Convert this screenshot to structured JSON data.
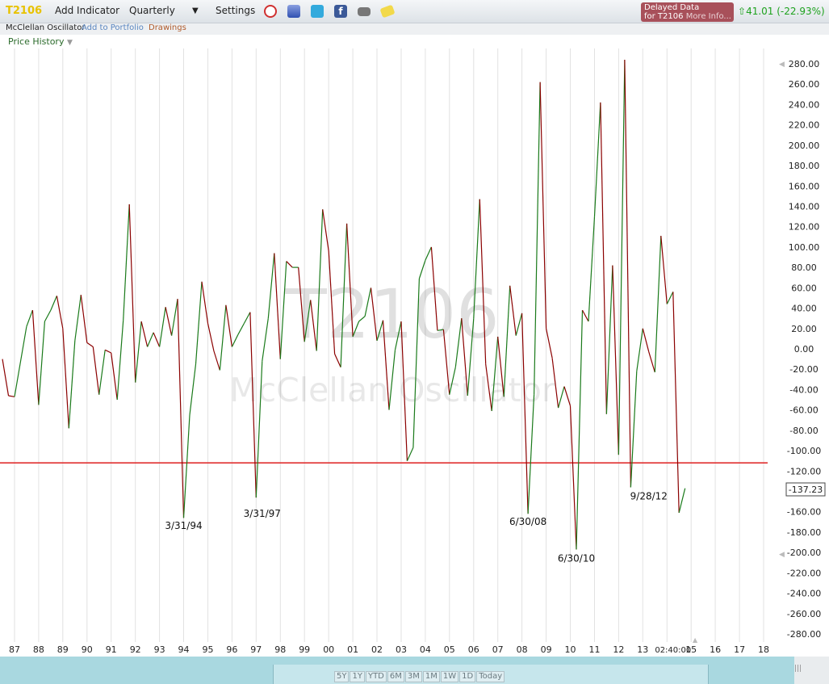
{
  "toolbar": {
    "symbol": "T2106",
    "add_indicator": "Add Indicator",
    "period": "Quarterly",
    "settings": "Settings"
  },
  "delayed": {
    "line1": "Delayed Data",
    "line2": "for T2106",
    "more": "More Info..."
  },
  "quote": {
    "text": "41.01 (-22.93%)",
    "color": "#1ea21e"
  },
  "subbar": {
    "indicator": "McClellan Oscillator",
    "add_portfolio": "Add to Portfolio",
    "drawings": "Drawings"
  },
  "price_history": "Price History",
  "watermark": {
    "symbol": "T2106",
    "name": "McClellan Oscillator"
  },
  "last_value_label": "-137.23",
  "time_label": "02:40:00",
  "nav_buttons": [
    "5Y",
    "1Y",
    "YTD",
    "6M",
    "3M",
    "1M",
    "1W",
    "1D",
    "Today"
  ],
  "colors": {
    "up": "#1a7a1a",
    "down": "#8b0000",
    "threshold": "#e03030"
  },
  "chart_data": {
    "type": "line",
    "ylim": [
      -280,
      280
    ],
    "yticks": [
      280,
      260,
      240,
      220,
      200,
      180,
      160,
      140,
      120,
      100,
      80,
      60,
      40,
      20,
      0,
      -20,
      -40,
      -60,
      -80,
      -100,
      -120,
      -140,
      -160,
      -180,
      -200,
      -220,
      -240,
      -260,
      -280
    ],
    "xlim": [
      1986.5,
      2018.3
    ],
    "xticks": [
      {
        "x": 1987,
        "label": "87"
      },
      {
        "x": 1988,
        "label": "88"
      },
      {
        "x": 1989,
        "label": "89"
      },
      {
        "x": 1990,
        "label": "90"
      },
      {
        "x": 1991,
        "label": "91"
      },
      {
        "x": 1992,
        "label": "92"
      },
      {
        "x": 1993,
        "label": "93"
      },
      {
        "x": 1994,
        "label": "94"
      },
      {
        "x": 1995,
        "label": "95"
      },
      {
        "x": 1996,
        "label": "96"
      },
      {
        "x": 1997,
        "label": "97"
      },
      {
        "x": 1998,
        "label": "98"
      },
      {
        "x": 1999,
        "label": "99"
      },
      {
        "x": 2000,
        "label": "00"
      },
      {
        "x": 2001,
        "label": "01"
      },
      {
        "x": 2002,
        "label": "02"
      },
      {
        "x": 2003,
        "label": "03"
      },
      {
        "x": 2004,
        "label": "04"
      },
      {
        "x": 2005,
        "label": "05"
      },
      {
        "x": 2006,
        "label": "06"
      },
      {
        "x": 2007,
        "label": "07"
      },
      {
        "x": 2008,
        "label": "08"
      },
      {
        "x": 2009,
        "label": "09"
      },
      {
        "x": 2010,
        "label": "10"
      },
      {
        "x": 2011,
        "label": "11"
      },
      {
        "x": 2012,
        "label": "12"
      },
      {
        "x": 2013,
        "label": "13"
      },
      {
        "x": 2015,
        "label": "15"
      },
      {
        "x": 2016,
        "label": "16"
      },
      {
        "x": 2017,
        "label": "17"
      },
      {
        "x": 2018,
        "label": "18"
      }
    ],
    "threshold": -112,
    "series": [
      {
        "points": [
          [
            1986.5,
            -10
          ],
          [
            1986.75,
            -46
          ],
          [
            1987.0,
            -47
          ],
          [
            1987.5,
            22
          ],
          [
            1987.75,
            38
          ],
          [
            1988.0,
            -55
          ],
          [
            1988.25,
            27
          ],
          [
            1988.5,
            38
          ],
          [
            1988.75,
            52
          ],
          [
            1989.0,
            20
          ],
          [
            1989.25,
            -78
          ],
          [
            1989.5,
            8
          ],
          [
            1989.75,
            53
          ],
          [
            1990.0,
            6
          ],
          [
            1990.25,
            2
          ],
          [
            1990.5,
            -45
          ],
          [
            1990.75,
            -1
          ],
          [
            1991.0,
            -4
          ],
          [
            1991.25,
            -50
          ],
          [
            1991.5,
            28
          ],
          [
            1991.75,
            142
          ],
          [
            1992.0,
            -33
          ],
          [
            1992.25,
            27
          ],
          [
            1992.5,
            2
          ],
          [
            1992.75,
            16
          ],
          [
            1993.0,
            2
          ],
          [
            1993.25,
            41
          ],
          [
            1993.5,
            13
          ],
          [
            1993.75,
            49
          ],
          [
            1994.0,
            -166
          ],
          [
            1994.25,
            -65
          ],
          [
            1994.5,
            -15
          ],
          [
            1994.75,
            66
          ],
          [
            1995.0,
            25
          ],
          [
            1995.25,
            -2
          ],
          [
            1995.5,
            -21
          ],
          [
            1995.75,
            43
          ],
          [
            1996.0,
            2
          ],
          [
            1996.25,
            14
          ],
          [
            1996.5,
            25
          ],
          [
            1996.75,
            36
          ],
          [
            1997.0,
            -146
          ],
          [
            1997.25,
            -12
          ],
          [
            1997.5,
            30
          ],
          [
            1997.75,
            94
          ],
          [
            1998.0,
            -10
          ],
          [
            1998.25,
            86
          ],
          [
            1998.5,
            80
          ],
          [
            1998.75,
            80
          ],
          [
            1999.0,
            7
          ],
          [
            1999.25,
            48
          ],
          [
            1999.5,
            -2
          ],
          [
            1999.75,
            137
          ],
          [
            2000.0,
            96
          ],
          [
            2000.25,
            -5
          ],
          [
            2000.5,
            -18
          ],
          [
            2000.75,
            123
          ],
          [
            2001.0,
            12
          ],
          [
            2001.25,
            27
          ],
          [
            2001.5,
            32
          ],
          [
            2001.75,
            60
          ],
          [
            2002.0,
            8
          ],
          [
            2002.25,
            28
          ],
          [
            2002.5,
            -60
          ],
          [
            2002.75,
            -1
          ],
          [
            2003.0,
            27
          ],
          [
            2003.25,
            -110
          ],
          [
            2003.5,
            -97
          ],
          [
            2003.75,
            69
          ],
          [
            2004.0,
            87
          ],
          [
            2004.25,
            100
          ],
          [
            2004.5,
            18
          ],
          [
            2004.75,
            19
          ],
          [
            2005.0,
            -45
          ],
          [
            2005.25,
            -18
          ],
          [
            2005.5,
            30
          ],
          [
            2005.75,
            -46
          ],
          [
            2006.0,
            30
          ],
          [
            2006.25,
            147
          ],
          [
            2006.5,
            -15
          ],
          [
            2006.75,
            -61
          ],
          [
            2007.0,
            12
          ],
          [
            2007.25,
            -47
          ],
          [
            2007.5,
            62
          ],
          [
            2007.75,
            13
          ],
          [
            2008.0,
            35
          ],
          [
            2008.25,
            -162
          ],
          [
            2008.5,
            -45
          ],
          [
            2008.75,
            262
          ],
          [
            2009.0,
            20
          ],
          [
            2009.25,
            -9
          ],
          [
            2009.5,
            -58
          ],
          [
            2009.75,
            -37
          ],
          [
            2010.0,
            -56
          ],
          [
            2010.25,
            -197
          ],
          [
            2010.5,
            38
          ],
          [
            2010.75,
            27
          ],
          [
            2011.0,
            130
          ],
          [
            2011.25,
            242
          ],
          [
            2011.5,
            -64
          ],
          [
            2011.75,
            82
          ],
          [
            2012.0,
            -104
          ],
          [
            2012.25,
            284
          ],
          [
            2012.5,
            -136
          ],
          [
            2012.75,
            -22
          ],
          [
            2013.0,
            20
          ],
          [
            2013.25,
            -3
          ],
          [
            2013.5,
            -23
          ],
          [
            2013.75,
            111
          ],
          [
            2014.0,
            44
          ],
          [
            2014.25,
            56
          ],
          [
            2014.5,
            -161
          ],
          [
            2014.75,
            -137
          ]
        ]
      }
    ],
    "annotations": [
      {
        "x": 1994.0,
        "y": -177,
        "text": "3/31/94"
      },
      {
        "x": 1997.25,
        "y": -165,
        "text": "3/31/97"
      },
      {
        "x": 2008.25,
        "y": -173,
        "text": "6/30/08"
      },
      {
        "x": 2010.25,
        "y": -209,
        "text": "6/30/10"
      },
      {
        "x": 2013.25,
        "y": -148,
        "text": "9/28/12"
      }
    ]
  }
}
